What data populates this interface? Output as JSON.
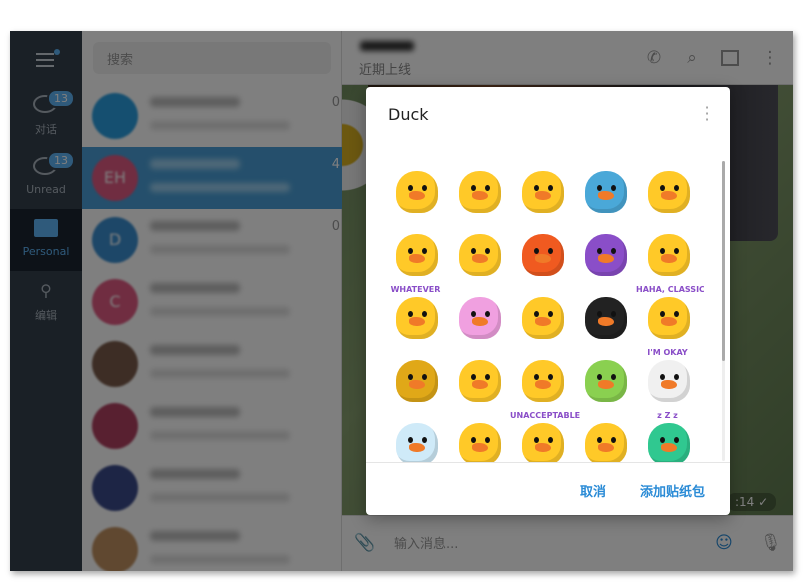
{
  "sidebar": {
    "folders": [
      {
        "label": "对话",
        "badge": "13",
        "icon": "chats-icon"
      },
      {
        "label": "Unread",
        "badge": "13",
        "icon": "chats-icon"
      },
      {
        "label": "Personal",
        "icon": "folder-icon",
        "active": true
      },
      {
        "label": "编辑",
        "icon": "sliders-icon"
      }
    ]
  },
  "chat_list": {
    "search_placeholder": "搜索",
    "rows": [
      {
        "avatar": "",
        "color": "#2a9ee0",
        "time": "0"
      },
      {
        "avatar": "EH",
        "color": "#e05a82",
        "time": "4",
        "selected": true
      },
      {
        "avatar": "D",
        "color": "#3a8ed0",
        "time": "0"
      },
      {
        "avatar": "C",
        "color": "#e05a82",
        "time": ""
      },
      {
        "avatar": "",
        "color": "#7a5a4a",
        "time": ""
      },
      {
        "avatar": "",
        "color": "#b04060",
        "time": ""
      },
      {
        "avatar": "",
        "color": "#3a4a8a",
        "time": ""
      },
      {
        "avatar": "",
        "color": "#c09060",
        "time": ""
      }
    ]
  },
  "chat": {
    "status": "近期上线",
    "message_time": ":14",
    "input_placeholder": "输入消息..."
  },
  "modal": {
    "title": "Duck",
    "cancel": "取消",
    "add": "添加贴纸包",
    "stickers": [
      {
        "color": "#ffc928",
        "caption": ""
      },
      {
        "color": "#ffc928",
        "caption": ""
      },
      {
        "color": "#ffc928",
        "caption": ""
      },
      {
        "color": "#4aa8d8",
        "caption": ""
      },
      {
        "color": "#ffc928",
        "caption": ""
      },
      {
        "color": "#ffc928",
        "caption": ""
      },
      {
        "color": "#ffc928",
        "caption": ""
      },
      {
        "color": "#f05a20",
        "caption": ""
      },
      {
        "color": "#8a4ec8",
        "caption": ""
      },
      {
        "color": "#ffc928",
        "caption": ""
      },
      {
        "color": "#ffc928",
        "caption": "WHATEVER"
      },
      {
        "color": "#f0a0e0",
        "caption": ""
      },
      {
        "color": "#ffc928",
        "caption": ""
      },
      {
        "color": "#222222",
        "caption": ""
      },
      {
        "color": "#ffc928",
        "caption": "HAHA, CLASSIC"
      },
      {
        "color": "#e0a818",
        "caption": ""
      },
      {
        "color": "#ffc928",
        "caption": ""
      },
      {
        "color": "#ffc928",
        "caption": ""
      },
      {
        "color": "#8ad050",
        "caption": ""
      },
      {
        "color": "#f0f0f0",
        "caption": "I'M OKAY"
      },
      {
        "color": "#cfeaf8",
        "caption": ""
      },
      {
        "color": "#ffc928",
        "caption": ""
      },
      {
        "color": "#ffc928",
        "caption": "UNACCEPTABLE"
      },
      {
        "color": "#ffc928",
        "caption": ""
      },
      {
        "color": "#30c890",
        "caption": "z Z z"
      }
    ]
  }
}
